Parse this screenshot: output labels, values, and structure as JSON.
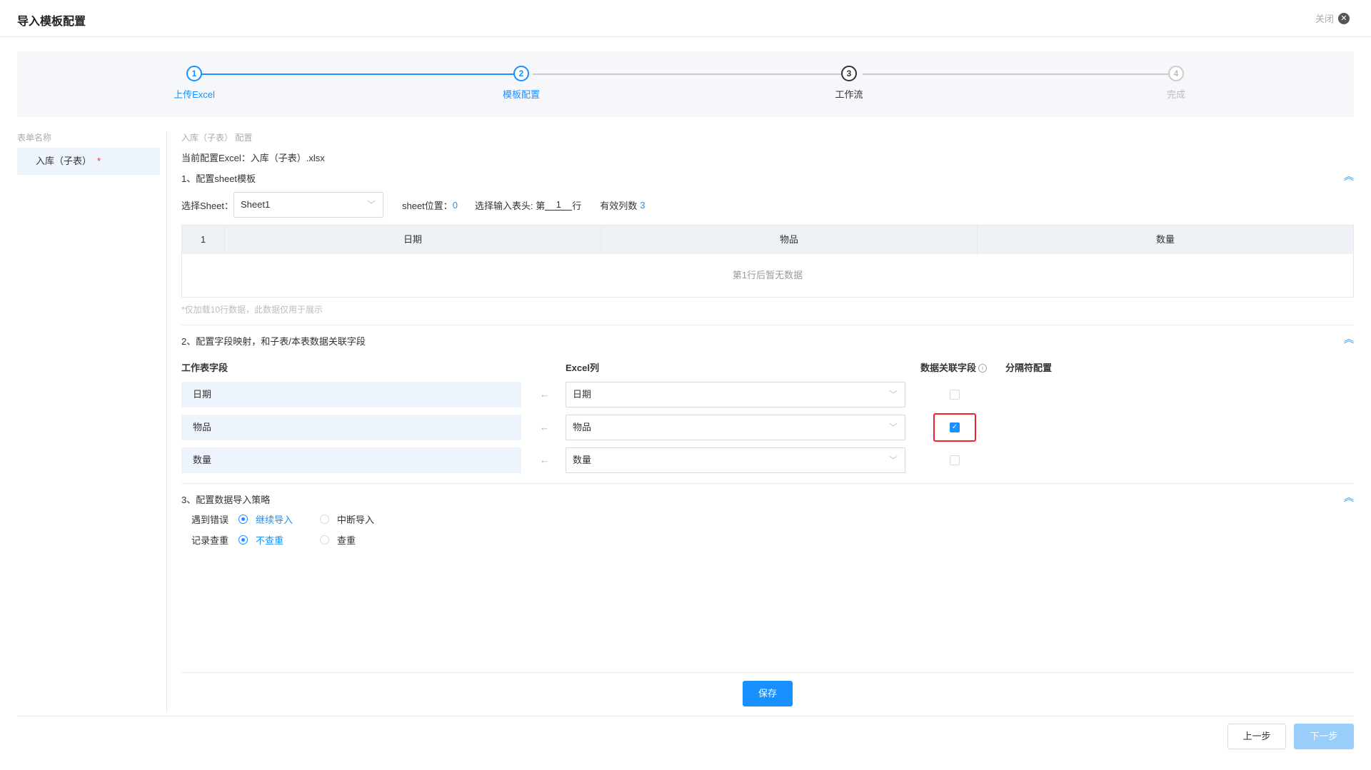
{
  "header": {
    "title": "导入模板配置",
    "close_label": "关闭",
    "close_icon": "close-circle-icon"
  },
  "steps": [
    {
      "number": "1",
      "label": "上传Excel",
      "state": "done"
    },
    {
      "number": "2",
      "label": "模板配置",
      "state": "active"
    },
    {
      "number": "3",
      "label": "工作流",
      "state": "current"
    },
    {
      "number": "4",
      "label": "完成",
      "state": "pending"
    }
  ],
  "sidebar": {
    "caption": "表单名称",
    "item": "入库（子表）",
    "required_mark": "*"
  },
  "main": {
    "breadcrumb": "入库（子表） 配置",
    "current_excel_label": "当前配置Excel：",
    "current_excel_value": "入库（子表）.xlsx",
    "section1": {
      "title": "1、配置sheet模板",
      "select_sheet_label": "选择Sheet：",
      "sheet_value": "Sheet1",
      "sheet_pos_label": "sheet位置：",
      "sheet_pos_value": "0",
      "header_row_prefix": "选择输入表头: 第",
      "header_row_value": "1",
      "header_row_suffix": "行",
      "valid_cols_label": "有效列数",
      "valid_cols_value": "3",
      "table_headers": [
        "1",
        "日期",
        "物品",
        "数量"
      ],
      "empty_text": "第1行后暂无数据",
      "note": "*仅加载10行数据，此数据仅用于展示"
    },
    "section2": {
      "title": "2、配置字段映射，和子表/本表数据关联字段",
      "col_field": "工作表字段",
      "col_excel": "Excel列",
      "col_link": "数据关联字段",
      "col_sep": "分隔符配置",
      "rows": [
        {
          "field": "日期",
          "excel": "日期",
          "linked": false
        },
        {
          "field": "物品",
          "excel": "物品",
          "linked": true
        },
        {
          "field": "数量",
          "excel": "数量",
          "linked": false
        }
      ]
    },
    "section3": {
      "title": "3、配置数据导入策略",
      "error_label": "遇到错误",
      "error_opt1": "继续导入",
      "error_opt2": "中断导入",
      "dup_label": "记录查重",
      "dup_opt1": "不查重",
      "dup_opt2": "查重"
    },
    "save_label": "保存"
  },
  "footer": {
    "prev_label": "上一步",
    "next_label": "下一步"
  },
  "colors": {
    "primary": "#1890ff",
    "highlight": "#f5222d",
    "disabled_button": "#99cdfa"
  }
}
